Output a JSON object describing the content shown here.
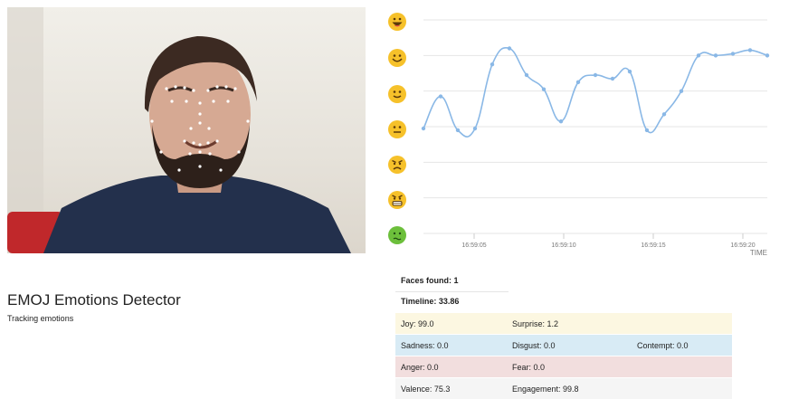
{
  "app": {
    "title": "EMOJ Emotions Detector",
    "subtitle": "Tracking emotions"
  },
  "emoji_scale": [
    "grinning-face-icon",
    "smiling-face-icon",
    "slightly-smiling-face-icon",
    "neutral-face-icon",
    "angry-face-icon",
    "grimacing-face-icon",
    "nauseated-face-icon"
  ],
  "colors": {
    "emoji_yellow": "#f6c12a",
    "emoji_green": "#6cbf3b",
    "line": "#8ab8e6",
    "grid": "#e6e6e6"
  },
  "stats": {
    "faces_found": "Faces found: 1",
    "timeline": "Timeline: 33.86",
    "rows": [
      {
        "c1": "Joy: 99.0",
        "c2": "Surprise: 1.2",
        "c3": ""
      },
      {
        "c1": "Sadness: 0.0",
        "c2": "Disgust: 0.0",
        "c3": "Contempt: 0.0"
      },
      {
        "c1": "Anger: 0.0",
        "c2": "Fear: 0.0",
        "c3": ""
      },
      {
        "c1": "Valence: 75.3",
        "c2": "Engagement: 99.8",
        "c3": ""
      }
    ]
  },
  "chart_data": {
    "type": "line",
    "xlabel": "TIME",
    "x_ticks": [
      "16:59:05",
      "16:59:10",
      "16:59:15",
      "16:59:20"
    ],
    "y_levels": 7,
    "values": [
      0.0,
      0.9,
      -0.05,
      0.0,
      1.8,
      2.25,
      1.5,
      1.1,
      0.2,
      1.3,
      1.5,
      1.4,
      1.6,
      -0.05,
      0.4,
      1.05,
      2.05,
      2.05,
      2.1,
      2.2,
      2.05
    ],
    "ylim": [
      -3,
      3
    ],
    "grid": true
  }
}
